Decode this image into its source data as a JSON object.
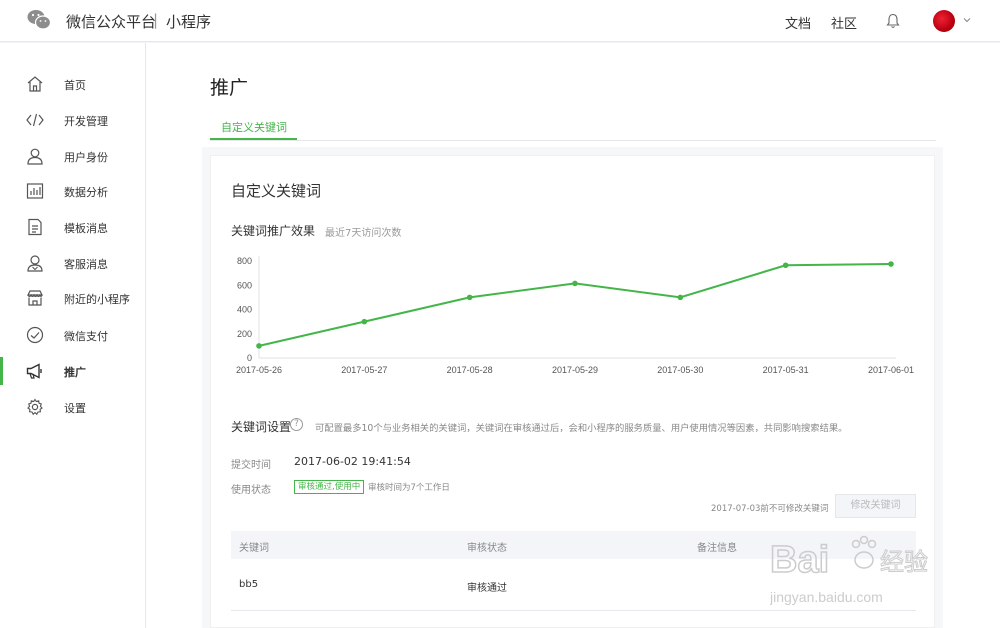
{
  "header": {
    "brand": "微信公众平台",
    "separator": "|",
    "sub": "小程序",
    "links": [
      "文档",
      "社区"
    ]
  },
  "sidebar": {
    "items": [
      {
        "label": "首页",
        "icon": "home-icon"
      },
      {
        "label": "开发管理",
        "icon": "code-icon"
      },
      {
        "label": "用户身份",
        "icon": "user-icon"
      },
      {
        "label": "数据分析",
        "icon": "bar-chart-icon"
      },
      {
        "label": "模板消息",
        "icon": "document-icon"
      },
      {
        "label": "客服消息",
        "icon": "support-icon"
      },
      {
        "label": "附近的小程序",
        "icon": "store-icon"
      },
      {
        "label": "微信支付",
        "icon": "pay-icon"
      },
      {
        "label": "推广",
        "icon": "megaphone-icon",
        "active": true
      },
      {
        "label": "设置",
        "icon": "gear-icon"
      }
    ],
    "accent": "#44b549"
  },
  "main": {
    "page_title": "推广",
    "tab": "自定义关键词",
    "section_title": "自定义关键词",
    "chart_title": "关键词推广效果",
    "chart_subtitle": "最近7天访问次数",
    "keyword_settings": {
      "title": "关键词设置",
      "help": "?",
      "description": "可配置最多10个与业务相关的关键词，关键词在审核通过后，会和小程序的服务质量、用户使用情况等因素，共同影响搜索结果。",
      "submit_label": "提交时间",
      "submit_value": "2017-06-02 19:41:54",
      "status_label": "使用状态",
      "status_badge": "审核通过,使用中",
      "status_note": "审核时间为7个工作日",
      "modify_note": "2017-07-03前不可修改关键词",
      "modify_button": "修改关键词"
    },
    "table": {
      "headers": [
        "关键词",
        "审核状态",
        "备注信息"
      ],
      "rows": [
        [
          "bb5",
          "审核通过",
          ""
        ]
      ]
    }
  },
  "watermark": {
    "text": "Bai",
    "text2": "经验",
    "url": "jingyan.baidu.com"
  },
  "chart_data": {
    "type": "line",
    "categories": [
      "2017-05-26",
      "2017-05-27",
      "2017-05-28",
      "2017-05-29",
      "2017-05-30",
      "2017-05-31",
      "2017-06-01"
    ],
    "values": [
      100,
      300,
      500,
      615,
      500,
      765,
      775
    ],
    "ylim": [
      0,
      800
    ],
    "yticks": [
      0,
      200,
      400,
      600,
      800
    ],
    "color": "#44b549",
    "grid": false
  }
}
